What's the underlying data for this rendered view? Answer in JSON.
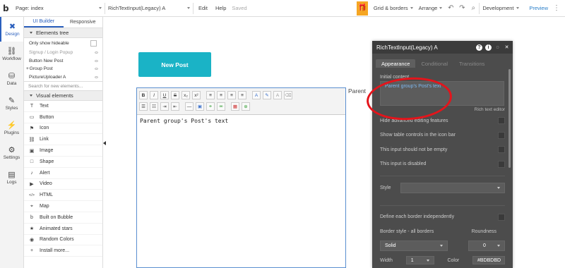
{
  "topbar": {
    "logo": "b",
    "page_label": "Page: index",
    "element_select": "RichTextInput(Legacy) A",
    "menu_edit": "Edit",
    "menu_help": "Help",
    "saved_status": "Saved",
    "gift_icon": "gift-icon",
    "grid_borders": "Grid & borders",
    "arrange": "Arrange",
    "environment": "Development",
    "preview": "Preview"
  },
  "rail": {
    "items": [
      {
        "label": "Design",
        "icon": "design-icon",
        "glyph": "✖"
      },
      {
        "label": "Workflow",
        "icon": "workflow-icon",
        "glyph": "⛓"
      },
      {
        "label": "Data",
        "icon": "data-icon",
        "glyph": "⛁"
      },
      {
        "label": "Styles",
        "icon": "styles-icon",
        "glyph": "✎"
      },
      {
        "label": "Plugins",
        "icon": "plugins-icon",
        "glyph": "⚡"
      },
      {
        "label": "Settings",
        "icon": "settings-icon",
        "glyph": "⚙"
      },
      {
        "label": "Logs",
        "icon": "logs-icon",
        "glyph": "▤"
      }
    ]
  },
  "panel": {
    "tabs": [
      "UI Builder",
      "Responsive"
    ],
    "elements_tree_header": "Elements tree",
    "only_show_hideable": "Only show hideable",
    "tree": [
      {
        "label": "Signup / Login Popup",
        "dim": true
      },
      {
        "label": "Button New Post",
        "dim": false
      },
      {
        "label": "Group Post",
        "dim": false
      },
      {
        "label": "PictureUploader A",
        "dim": false
      }
    ],
    "search_placeholder": "Search for new elements...",
    "visual_header": "Visual elements",
    "visual_elements": [
      {
        "label": "Text",
        "glyph": "T"
      },
      {
        "label": "Button",
        "glyph": "▭"
      },
      {
        "label": "Icon",
        "glyph": "⚑"
      },
      {
        "label": "Link",
        "glyph": "⛓"
      },
      {
        "label": "Image",
        "glyph": "▣"
      },
      {
        "label": "Shape",
        "glyph": "□"
      },
      {
        "label": "Alert",
        "glyph": "♪"
      },
      {
        "label": "Video",
        "glyph": "▶"
      },
      {
        "label": "HTML",
        "glyph": "</>"
      },
      {
        "label": "Map",
        "glyph": "⌖"
      },
      {
        "label": "Built on Bubble",
        "glyph": "b"
      },
      {
        "label": "Animated stars",
        "glyph": "★"
      },
      {
        "label": "Random Colors",
        "glyph": "◉"
      },
      {
        "label": "Install more...",
        "glyph": "+"
      }
    ]
  },
  "canvas": {
    "new_post_button": "New Post",
    "rte_content": "Parent group's Post's text",
    "parent_label": "Parent"
  },
  "props": {
    "title": "RichTextInput(Legacy) A",
    "tabs": [
      "Appearance",
      "Conditional",
      "Transitions"
    ],
    "initial_content_label": "Initial content",
    "initial_content_value": "Parent group's Post's text",
    "rich_text_editor": "Rich text editor",
    "checks": [
      "Hide advanced editing features",
      "Show table controls in the icon bar",
      "This input should not be empty",
      "This input is disabled"
    ],
    "style_label": "Style",
    "define_each_border": "Define each border independently",
    "border_style_label": "Border style - all borders",
    "roundness_label": "Roundness",
    "border_style_value": "Solid",
    "roundness_value": "0",
    "width_label": "Width",
    "width_value": "1",
    "color_label": "Color",
    "color_value": "#BDBDBD"
  },
  "colors": {
    "accent": "#2a5fbd",
    "button_teal": "#1ab3c6",
    "annotation_red": "#e4141b",
    "gift_orange": "#f5a623"
  }
}
